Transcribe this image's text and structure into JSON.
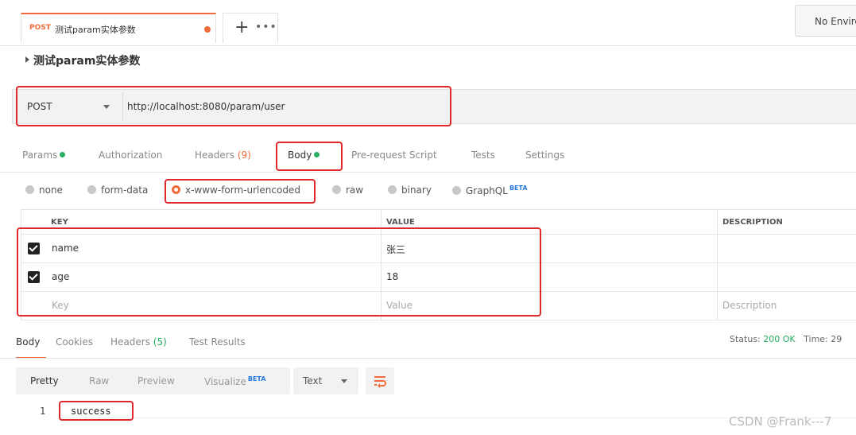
{
  "top_tab": {
    "method": "POST",
    "name": "测试param实体参数",
    "plus": "+",
    "more": "•••"
  },
  "environment": {
    "label": "No Environment"
  },
  "request_title": "测试param实体参数",
  "url_bar": {
    "method": "POST",
    "url": "http://localhost:8080/param/user"
  },
  "request_tabs": {
    "params": "Params",
    "authorization": "Authorization",
    "headers": "Headers",
    "headers_count": "(9)",
    "body": "Body",
    "pre_request": "Pre-request Script",
    "tests": "Tests",
    "settings": "Settings"
  },
  "body_types": {
    "none": "none",
    "form_data": "form-data",
    "urlencoded": "x-www-form-urlencoded",
    "raw": "raw",
    "binary": "binary",
    "graphql": "GraphQL",
    "beta": "BETA"
  },
  "params_table": {
    "headers": {
      "key": "KEY",
      "value": "VALUE",
      "description": "DESCRIPTION"
    },
    "rows": [
      {
        "key": "name",
        "value": "张三",
        "description": ""
      },
      {
        "key": "age",
        "value": "18",
        "description": ""
      }
    ],
    "placeholders": {
      "key": "Key",
      "value": "Value",
      "description": "Description"
    }
  },
  "response_tabs": {
    "body": "Body",
    "cookies": "Cookies",
    "headers": "Headers",
    "headers_count": "(5)",
    "test_results": "Test Results"
  },
  "status": {
    "status_label": "Status:",
    "status_value": "200 OK",
    "time_label": "Time:",
    "time_value": "29"
  },
  "response_view": {
    "pretty": "Pretty",
    "raw": "Raw",
    "preview": "Preview",
    "visualize": "Visualize",
    "beta": "BETA",
    "format": "Text"
  },
  "response_body": {
    "line_no": "1",
    "text": "success"
  },
  "watermark": "CSDN @Frank---7",
  "colors": {
    "accent": "#f26b3a",
    "green": "#27ae60",
    "annotation": "#e0282b"
  }
}
